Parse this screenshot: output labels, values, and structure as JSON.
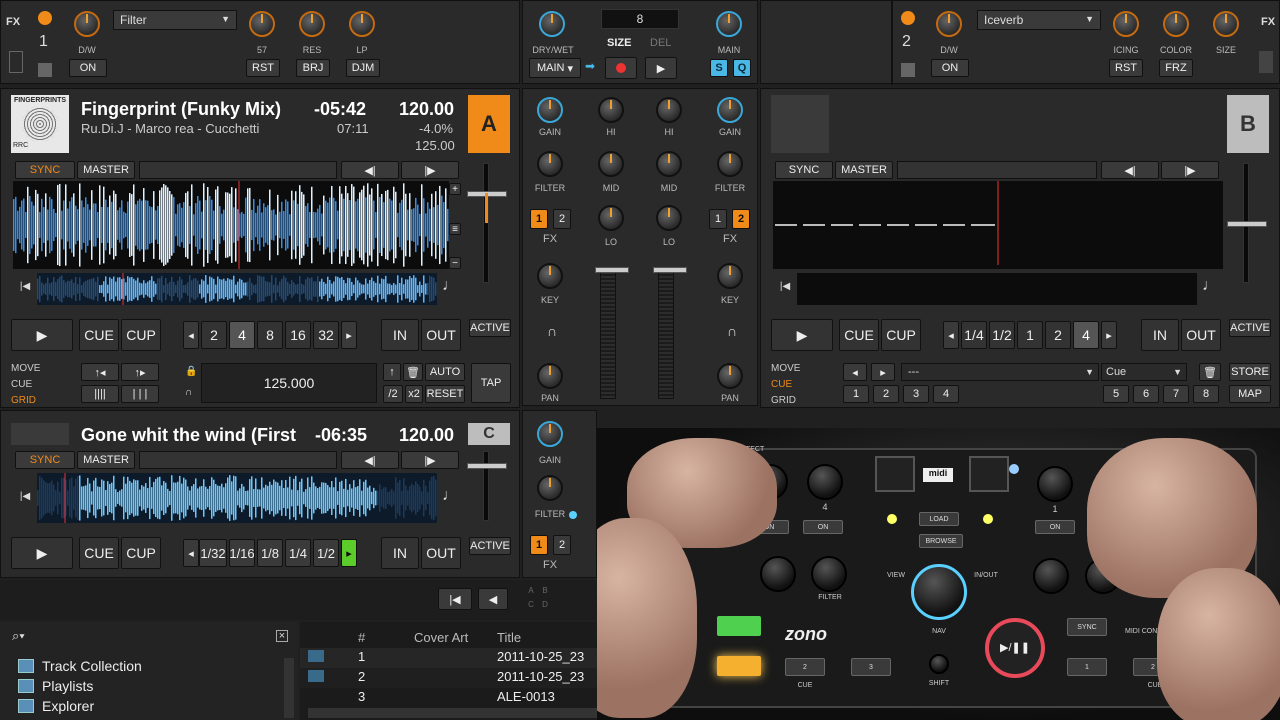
{
  "fx_left": {
    "label": "FX",
    "unit_number": "1",
    "effect": "Filter",
    "knob_labels": [
      "D/W",
      "57",
      "RES",
      "LP"
    ],
    "buttons": [
      "ON",
      "RST",
      "BRJ",
      "DJM"
    ]
  },
  "fx_right": {
    "label": "FX",
    "unit_number": "2",
    "effect": "Iceverb",
    "knob_labels": [
      "D/W",
      "ICING",
      "COLOR",
      "SIZE"
    ],
    "buttons": [
      "ON",
      "RST",
      "FRZ"
    ]
  },
  "master_center": {
    "dry_wet_label": "DRY/WET",
    "main_select": "MAIN",
    "size_value": "8",
    "size_label": "SIZE",
    "del_label": "DEL",
    "main_label": "MAIN",
    "s_label": "S",
    "q_label": "Q"
  },
  "deck_a": {
    "letter": "A",
    "title": "Fingerprint (Funky Mix)",
    "artist": "Ru.Di.J - Marco rea - Cucchetti",
    "remaining": "-05:42",
    "length": "07:11",
    "bpm": "120.00",
    "pitch": "-4.0%",
    "orig_bpm": "125.00",
    "cover_text": "FINGERPRINTS",
    "cover_sub": "RRC",
    "sync": "SYNC",
    "master": "MASTER",
    "play": "▶",
    "cue": "CUE",
    "cup": "CUP",
    "loop_sizes": [
      "2",
      "4",
      "8",
      "16",
      "32"
    ],
    "loop_selected": "4",
    "in": "IN",
    "out": "OUT",
    "active": "ACTIVE",
    "modes": [
      "MOVE",
      "CUE",
      "GRID"
    ],
    "grid_bpm": "125.000",
    "auto": "AUTO",
    "reset": "RESET",
    "half": "/2",
    "double": "x2",
    "tap": "TAP"
  },
  "deck_b": {
    "letter": "B",
    "sync": "SYNC",
    "master": "MASTER",
    "play": "▶",
    "cue": "CUE",
    "cup": "CUP",
    "loop_sizes": [
      "1/4",
      "1/2",
      "1",
      "2",
      "4"
    ],
    "loop_selected": "4",
    "in": "IN",
    "out": "OUT",
    "active": "ACTIVE",
    "modes": [
      "MOVE",
      "CUE",
      "GRID"
    ],
    "cue_name_value": "---",
    "cue_type": "Cue",
    "store": "STORE",
    "map": "MAP",
    "hotcues_left": [
      "1",
      "2",
      "3",
      "4"
    ],
    "hotcues_right": [
      "5",
      "6",
      "7",
      "8"
    ]
  },
  "deck_c": {
    "letter": "C",
    "title": "Gone whit the wind (First",
    "remaining": "-06:35",
    "bpm": "120.00",
    "sync": "SYNC",
    "master": "MASTER",
    "play": "▶",
    "cue": "CUE",
    "cup": "CUP",
    "loop_sizes": [
      "1/32",
      "1/16",
      "1/8",
      "1/4",
      "1/2"
    ],
    "in": "IN",
    "out": "OUT",
    "active": "ACTIVE"
  },
  "mixer": {
    "gain": "GAIN",
    "hi": "HI",
    "mid": "MID",
    "lo": "LO",
    "filter": "FILTER",
    "fx": "FX",
    "key": "KEY",
    "pan": "PAN",
    "fx1": "1",
    "fx2": "2"
  },
  "browser": {
    "tree": [
      "Track Collection",
      "Playlists",
      "Explorer"
    ],
    "columns": [
      "#",
      "Cover Art",
      "Title"
    ],
    "rows": [
      {
        "num": "1",
        "title": "2011-10-25_23"
      },
      {
        "num": "2",
        "title": "2011-10-25_23"
      },
      {
        "num": "3",
        "title": "ALE-0013"
      }
    ],
    "transport_labels": [
      "A",
      "B",
      "C",
      "D"
    ]
  },
  "controller": {
    "brand": "zono",
    "midi": "midi",
    "effect": "EFFECT",
    "load": "LOAD",
    "browse": "BROWSE",
    "view": "VIEW",
    "in_out": "IN/OUT",
    "nav": "NAV",
    "shift": "SHIFT",
    "sync": "SYNC",
    "cue": "CUE",
    "midi_controller": "MIDI CONTROLLE",
    "on": "ON",
    "filter": "FILTER",
    "knob_nums": [
      "3",
      "4",
      "1"
    ],
    "button_nums": [
      "2",
      "3",
      "1",
      "2"
    ]
  }
}
